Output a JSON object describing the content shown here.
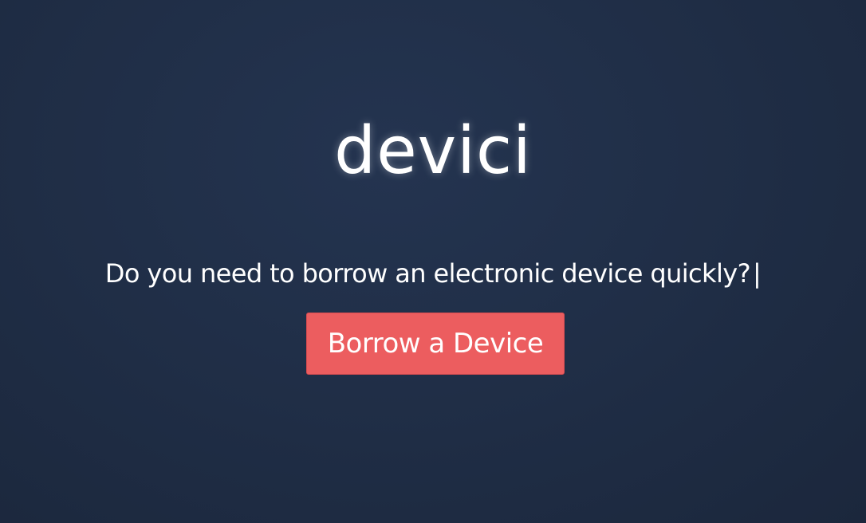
{
  "brand": {
    "logo_text": "devici"
  },
  "hero": {
    "tagline": "Do you need to borrow an electronic device quickly?",
    "cursor": "|",
    "cta_label": "Borrow a Device"
  },
  "colors": {
    "background": "#1f2d45",
    "cta_background": "#ec5d5f",
    "text": "#ffffff"
  }
}
